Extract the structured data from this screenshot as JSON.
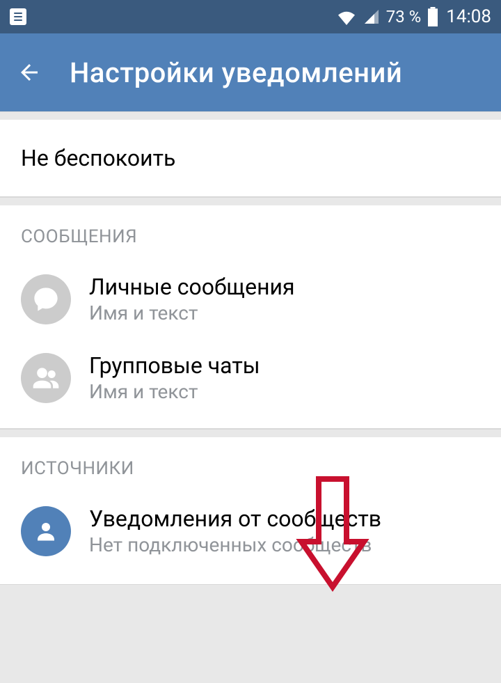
{
  "statusBar": {
    "battery": "73 %",
    "time": "14:08"
  },
  "appBar": {
    "title": "Настройки уведомлений"
  },
  "doNotDisturb": {
    "label": "Не беспокоить"
  },
  "messages": {
    "header": "СООБЩЕНИЯ",
    "personal": {
      "title": "Личные сообщения",
      "subtitle": "Имя и текст"
    },
    "group": {
      "title": "Групповые чаты",
      "subtitle": "Имя и текст"
    }
  },
  "sources": {
    "header": "ИСТОЧНИКИ",
    "communities": {
      "title": "Уведомления от сообществ",
      "subtitle": "Нет подключенных сообществ"
    }
  }
}
